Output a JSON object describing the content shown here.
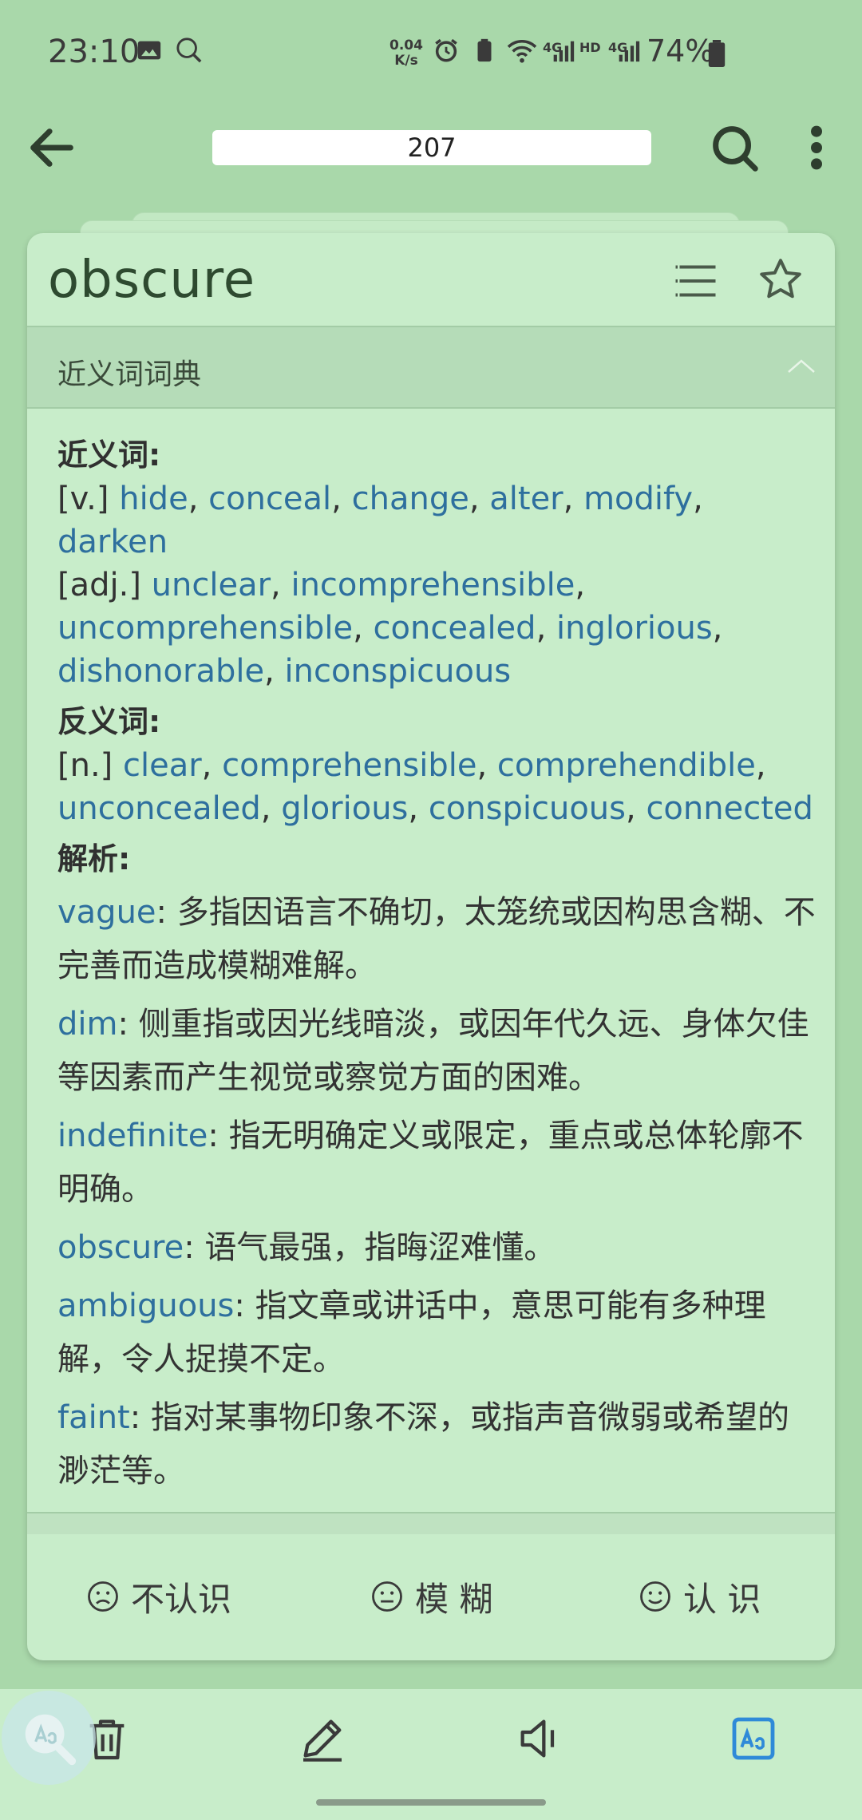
{
  "status_bar": {
    "time": "23:10",
    "net_speed_value": "0.04",
    "net_speed_unit": "K/s",
    "signal_1": "4G",
    "hd": "HD",
    "signal_2": "4G",
    "battery": "74%"
  },
  "toolbar": {
    "page_value": "207",
    "icons": [
      "arrow-left-icon",
      "search-icon",
      "more-vertical-icon"
    ]
  },
  "card": {
    "word": "obscure",
    "section_title": "近义词词典",
    "synonyms_heading": "近义词:",
    "synonyms": [
      {
        "pos": "[v.]",
        "words": [
          "hide",
          "conceal",
          "change",
          "alter",
          "modify",
          "darken"
        ]
      },
      {
        "pos": "[adj.]",
        "words": [
          "unclear",
          "incomprehensible",
          "uncomprehensible",
          "concealed",
          "inglorious",
          "dishonorable",
          "inconspicuous"
        ]
      }
    ],
    "antonyms_heading": "反义词:",
    "antonyms": [
      {
        "pos": "[n.]",
        "words": [
          "clear",
          "comprehensible",
          "comprehendible",
          "unconcealed",
          "glorious",
          "conspicuous",
          "connected"
        ]
      }
    ],
    "analysis_heading": "解析:",
    "analysis": [
      {
        "word": "vague",
        "text": ": 多指因语言不确切，太笼统或因构思含糊、不完善而造成模糊难解。"
      },
      {
        "word": "dim",
        "text": ": 侧重指或因光线暗淡，或因年代久远、身体欠佳等因素而产生视觉或察觉方面的困难。"
      },
      {
        "word": "indefinite",
        "text": ": 指无明确定义或限定，重点或总体轮廓不明确。"
      },
      {
        "word": "obscure",
        "text": ": 语气最强，指晦涩难懂。"
      },
      {
        "word": "ambiguous",
        "text": ": 指文章或讲话中，意思可能有多种理解，令人捉摸不定。"
      },
      {
        "word": "faint",
        "text": ": 指对某事物印象不深，或指声音微弱或希望的渺茫等。"
      }
    ]
  },
  "rating": {
    "unknown": "不认识",
    "vague": "模 糊",
    "known": "认 识"
  },
  "bottom_bar": {
    "icons": [
      "trash-icon",
      "edit-icon",
      "speaker-icon",
      "font-size-icon"
    ],
    "accent": "#2f8ad8"
  },
  "colors": {
    "background": "#a9d8aa",
    "card": "#c8edca",
    "link": "#2e6f9e"
  }
}
